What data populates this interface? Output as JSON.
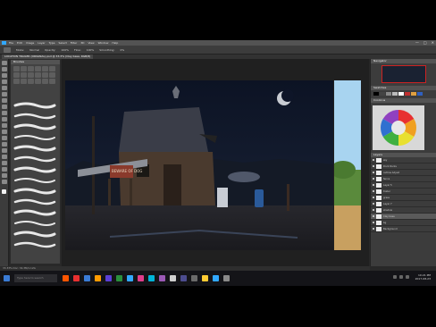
{
  "app": {
    "name": "Photoshop",
    "menu": [
      "File",
      "Edit",
      "Image",
      "Layer",
      "Type",
      "Select",
      "Filter",
      "3D",
      "View",
      "Window",
      "Help"
    ],
    "window_controls": [
      "—",
      "□",
      "✕"
    ]
  },
  "options_bar": {
    "items": [
      "Mode:",
      "Normal",
      "Opacity:",
      "100%",
      "Flow:",
      "100%",
      "Smoothing:",
      "0%"
    ]
  },
  "document_tab": {
    "title": "LOCATION TRAILER (ORIGINAL).psd @ 33.3% (Clay base, RGB/8)"
  },
  "brush_panel": {
    "title": "Brushes",
    "brush_tip_count": 27
  },
  "right_panels": {
    "navigator_title": "Navigator",
    "swatches_title": "Swatches",
    "color_wheel_title": "Coolorus",
    "layers_title": "Layers",
    "swatch_colors": [
      "#000000",
      "#444444",
      "#888888",
      "#bbbbbb",
      "#ffffff",
      "#c03030",
      "#e0a040",
      "#3060c0"
    ],
    "layers": [
      {
        "name": "sky",
        "selected": false
      },
      {
        "name": "Dock Rocks",
        "selected": false
      },
      {
        "name": "outline Adjust",
        "selected": false
      },
      {
        "name": "fence",
        "selected": false
      },
      {
        "name": "Layer 5",
        "selected": false
      },
      {
        "name": "trailer",
        "selected": false
      },
      {
        "name": "grass",
        "selected": false
      },
      {
        "name": "Layer 7",
        "selected": false
      },
      {
        "name": "shadow",
        "selected": false
      },
      {
        "name": "Clay base",
        "selected": true
      },
      {
        "name": "bg",
        "selected": false
      },
      {
        "name": "Background",
        "selected": false
      }
    ]
  },
  "status": {
    "text": "33.33%    Doc: 34.3M/1.12G"
  },
  "taskbar": {
    "search_placeholder": "Type here to search",
    "apps": [
      "#ff5500",
      "#e83030",
      "#3a7bd5",
      "#ff9b00",
      "#5b3fd6",
      "#2a8f3c",
      "#31a8ff",
      "#e03c8a",
      "#00b4d8",
      "#9b59b6",
      "#cfcfcf",
      "#4c4c8f",
      "#6a6a6a",
      "#ffcc33",
      "#31a8ff",
      "#8a8a8a"
    ],
    "time": "10:21 PM",
    "date": "2017-08-23"
  },
  "canvas": {
    "sign_text": "BEWARE OF DOG"
  }
}
